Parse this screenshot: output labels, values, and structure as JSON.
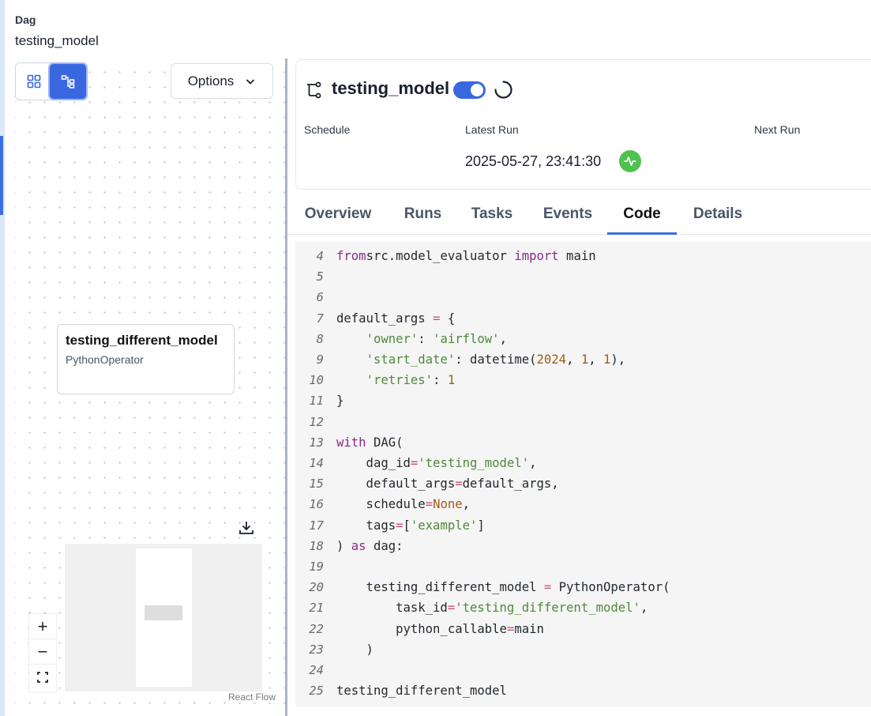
{
  "breadcrumb": {
    "label": "Dag",
    "value": "testing_model"
  },
  "graph": {
    "options_label": "Options",
    "task_node": {
      "name": "testing_different_model",
      "operator": "PythonOperator"
    },
    "attribution": "React Flow",
    "zoom_in_glyph": "+",
    "zoom_out_glyph": "−"
  },
  "icons": {
    "grid_view": "grid-icon",
    "graph_view": "graph-icon",
    "dag": "dag-icon",
    "download": "download-icon",
    "status": "activity-icon",
    "fit_view": "fit-view-icon",
    "chevron": "chevron-down-icon"
  },
  "dag": {
    "title": "testing_model",
    "paused": false,
    "schedule_label": "Schedule",
    "latest_run_label": "Latest Run",
    "latest_run_value": "2025-05-27, 23:41:30",
    "next_run_label": "Next Run",
    "latest_run_status_color": "#4ec24f"
  },
  "tabs": [
    {
      "label": "Overview",
      "active": false
    },
    {
      "label": "Runs",
      "active": false
    },
    {
      "label": "Tasks",
      "active": false
    },
    {
      "label": "Events",
      "active": false
    },
    {
      "label": "Code",
      "active": true
    },
    {
      "label": "Details",
      "active": false
    }
  ],
  "code": {
    "lines": [
      {
        "n": "4",
        "tokens": [
          [
            "kw",
            "from"
          ],
          [
            "",
            "src.model_evaluator "
          ],
          [
            "kw",
            "import"
          ],
          [
            "",
            " main"
          ]
        ]
      },
      {
        "n": "5",
        "tokens": []
      },
      {
        "n": "6",
        "tokens": []
      },
      {
        "n": "7",
        "tokens": [
          [
            "",
            "default_args "
          ],
          [
            "op",
            "="
          ],
          [
            "",
            " {"
          ]
        ]
      },
      {
        "n": "8",
        "tokens": [
          [
            "",
            "    "
          ],
          [
            "str",
            "'owner'"
          ],
          [
            "",
            ": "
          ],
          [
            "str",
            "'airflow'"
          ],
          [
            "",
            ","
          ]
        ]
      },
      {
        "n": "9",
        "tokens": [
          [
            "",
            "    "
          ],
          [
            "str",
            "'start_date'"
          ],
          [
            "",
            ": datetime("
          ],
          [
            "num",
            "2024"
          ],
          [
            "",
            ", "
          ],
          [
            "num",
            "1"
          ],
          [
            "",
            ", "
          ],
          [
            "num",
            "1"
          ],
          [
            "",
            "),"
          ]
        ]
      },
      {
        "n": "10",
        "tokens": [
          [
            "",
            "    "
          ],
          [
            "str",
            "'retries'"
          ],
          [
            "",
            ": "
          ],
          [
            "num",
            "1"
          ]
        ]
      },
      {
        "n": "11",
        "tokens": [
          [
            "",
            "}"
          ]
        ]
      },
      {
        "n": "12",
        "tokens": []
      },
      {
        "n": "13",
        "tokens": [
          [
            "kw",
            "with"
          ],
          [
            "",
            " DAG("
          ]
        ]
      },
      {
        "n": "14",
        "tokens": [
          [
            "",
            "    dag_id"
          ],
          [
            "op",
            "="
          ],
          [
            "str",
            "'testing_model'"
          ],
          [
            "",
            ","
          ]
        ]
      },
      {
        "n": "15",
        "tokens": [
          [
            "",
            "    default_args"
          ],
          [
            "op",
            "="
          ],
          [
            "",
            "default_args,"
          ]
        ]
      },
      {
        "n": "16",
        "tokens": [
          [
            "",
            "    schedule"
          ],
          [
            "op",
            "="
          ],
          [
            "nn",
            "None"
          ],
          [
            "",
            ","
          ]
        ]
      },
      {
        "n": "17",
        "tokens": [
          [
            "",
            "    tags"
          ],
          [
            "op",
            "="
          ],
          [
            "",
            "["
          ],
          [
            "str",
            "'example'"
          ],
          [
            "",
            "]"
          ]
        ]
      },
      {
        "n": "18",
        "tokens": [
          [
            "",
            ") "
          ],
          [
            "kw",
            "as"
          ],
          [
            "",
            " dag:"
          ]
        ]
      },
      {
        "n": "19",
        "tokens": []
      },
      {
        "n": "20",
        "tokens": [
          [
            "",
            "    testing_different_model "
          ],
          [
            "op",
            "="
          ],
          [
            "",
            " PythonOperator("
          ]
        ]
      },
      {
        "n": "21",
        "tokens": [
          [
            "",
            "        task_id"
          ],
          [
            "op",
            "="
          ],
          [
            "str",
            "'testing_different_model'"
          ],
          [
            "",
            ","
          ]
        ]
      },
      {
        "n": "22",
        "tokens": [
          [
            "",
            "        python_callable"
          ],
          [
            "op",
            "="
          ],
          [
            "",
            "main"
          ]
        ]
      },
      {
        "n": "23",
        "tokens": [
          [
            "",
            "    )"
          ]
        ]
      },
      {
        "n": "24",
        "tokens": []
      },
      {
        "n": "25",
        "tokens": [
          [
            "",
            "testing_different_model"
          ]
        ]
      }
    ]
  }
}
